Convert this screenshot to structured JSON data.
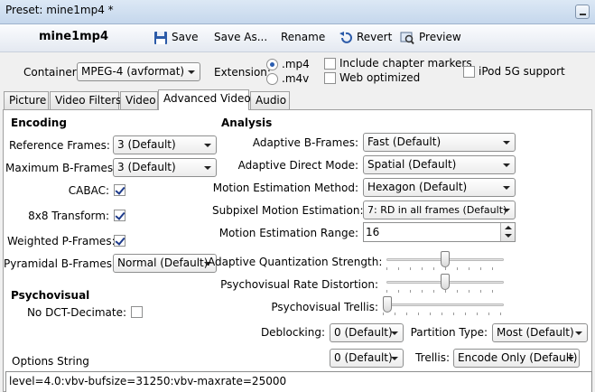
{
  "window": {
    "title": "Preset: mine1mp4 *"
  },
  "toolbar": {
    "preset_name": "mine1mp4",
    "save": "Save",
    "save_as": "Save As...",
    "rename": "Rename",
    "revert": "Revert",
    "preview": "Preview"
  },
  "container": {
    "label": "Container:",
    "value": "MPEG-4 (avformat)",
    "extension_label": "Extension:",
    "ext_mp4": ".mp4",
    "ext_m4v": ".m4v",
    "selected_extension": ".mp4",
    "include_chapter_markers": "Include chapter markers",
    "include_chapter_markers_checked": false,
    "web_optimized": "Web optimized",
    "web_optimized_checked": false,
    "ipod_5g": "iPod 5G support",
    "ipod_5g_checked": false
  },
  "tabs": [
    {
      "label": "Picture",
      "active": false
    },
    {
      "label": "Video Filters",
      "active": false
    },
    {
      "label": "Video",
      "active": false
    },
    {
      "label": "Advanced Video",
      "active": true
    },
    {
      "label": "Audio",
      "active": false
    }
  ],
  "encoding": {
    "heading": "Encoding",
    "reference_frames_label": "Reference Frames:",
    "reference_frames": "3 (Default)",
    "max_b_frames_label": "Maximum B-Frames:",
    "max_b_frames": "3 (Default)",
    "cabac_label": "CABAC:",
    "cabac_checked": true,
    "transform_label": "8x8 Transform:",
    "transform_checked": true,
    "weighted_p_label": "Weighted P-Frames:",
    "weighted_p_checked": true,
    "pyramidal_label": "Pyramidal B-Frames:",
    "pyramidal": "Normal (Default)"
  },
  "psychovisual": {
    "heading": "Psychovisual",
    "no_dct_label": "No DCT-Decimate:",
    "no_dct_checked": false
  },
  "analysis": {
    "heading": "Analysis",
    "adaptive_b_label": "Adaptive B-Frames:",
    "adaptive_b": "Fast (Default)",
    "direct_mode_label": "Adaptive Direct Mode:",
    "direct_mode": "Spatial (Default)",
    "me_method_label": "Motion Estimation Method:",
    "me_method": "Hexagon (Default)",
    "subpixel_label": "Subpixel Motion Estimation:",
    "subpixel": "7: RD in all frames (Default)",
    "me_range_label": "Motion Estimation Range:",
    "me_range": "16",
    "aq_label": "Adaptive Quantization Strength:",
    "aq_level": 0.5,
    "psy_rd_label": "Psychovisual Rate Distortion:",
    "psy_rd_level": 0.5,
    "psy_trellis_label": "Psychovisual Trellis:",
    "psy_trellis_level": 0.0,
    "deblocking_label": "Deblocking:",
    "deblocking_1": "0 (Default)",
    "deblocking_2": "0 (Default)",
    "partition_label": "Partition Type:",
    "partition": "Most (Default)",
    "trellis_label": "Trellis:",
    "trellis": "Encode Only (Default)"
  },
  "options_string": {
    "label": "Options String",
    "value": "level=4.0:vbv-bufsize=31250:vbv-maxrate=25000"
  }
}
